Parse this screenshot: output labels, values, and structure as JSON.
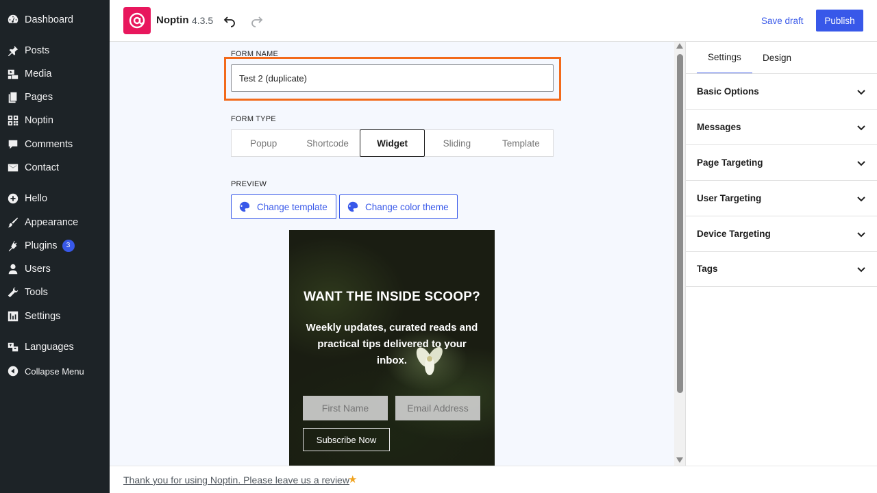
{
  "sidebar": {
    "items": [
      {
        "label": "Dashboard",
        "icon": "dashboard-icon"
      },
      {
        "label": "Posts",
        "icon": "pin-icon"
      },
      {
        "label": "Media",
        "icon": "media-icon"
      },
      {
        "label": "Pages",
        "icon": "pages-icon"
      },
      {
        "label": "Noptin",
        "icon": "qr-grid-icon"
      },
      {
        "label": "Comments",
        "icon": "comment-icon"
      },
      {
        "label": "Contact",
        "icon": "envelope-icon"
      },
      {
        "label": "Hello",
        "icon": "plus-circle-icon"
      },
      {
        "label": "Appearance",
        "icon": "brush-icon"
      },
      {
        "label": "Plugins",
        "icon": "plug-icon",
        "badge": "3"
      },
      {
        "label": "Users",
        "icon": "user-icon"
      },
      {
        "label": "Tools",
        "icon": "wrench-icon"
      },
      {
        "label": "Settings",
        "icon": "sliders-icon"
      },
      {
        "label": "Languages",
        "icon": "translate-icon"
      },
      {
        "label": "Collapse Menu",
        "icon": "collapse-icon"
      }
    ]
  },
  "topbar": {
    "app_name": "Noptin",
    "version": "4.3.5",
    "save_draft": "Save draft",
    "publish": "Publish"
  },
  "form": {
    "name_label": "FORM NAME",
    "name_value": "Test 2 (duplicate)",
    "type_label": "FORM TYPE",
    "types": [
      "Popup",
      "Shortcode",
      "Widget",
      "Sliding",
      "Template"
    ],
    "active_type": "Widget",
    "preview_label": "PREVIEW",
    "change_template": "Change template",
    "change_color_theme": "Change color theme"
  },
  "preview": {
    "title": "WANT THE INSIDE SCOOP?",
    "description": "Weekly updates, curated reads and practical tips delivered to your inbox.",
    "first_name_placeholder": "First Name",
    "email_placeholder": "Email Address",
    "subscribe": "Subscribe Now"
  },
  "panel": {
    "tabs": [
      "Settings",
      "Design"
    ],
    "active_tab": "Settings",
    "sections": [
      "Basic Options",
      "Messages",
      "Page Targeting",
      "User Targeting",
      "Device Targeting",
      "Tags"
    ]
  },
  "footer": {
    "review_text": "Thank you for using Noptin. Please leave us a review"
  },
  "colors": {
    "accent": "#3858e9",
    "sidebar_bg": "#1d2327",
    "highlight": "#f26a1b",
    "logo_bg": "#e8175d"
  }
}
